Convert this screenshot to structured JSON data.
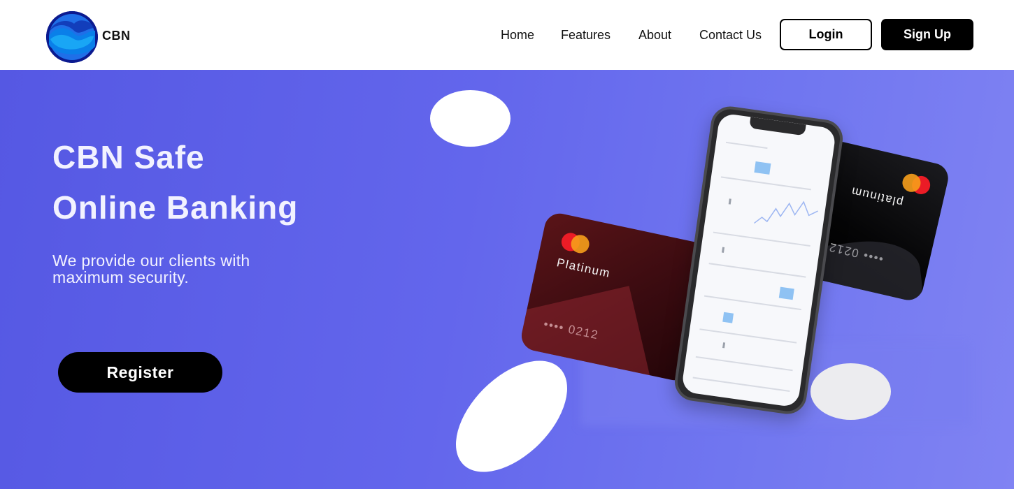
{
  "brand": {
    "name": "CBN"
  },
  "nav": {
    "items": [
      "Home",
      "Features",
      "About",
      "Contact Us"
    ],
    "login_label": "Login",
    "signup_label": "Sign Up"
  },
  "hero": {
    "title_line1": "CBN Safe",
    "title_line2": "Online Banking",
    "subtitle": "We provide our clients with maximum security.",
    "register_label": "Register"
  },
  "cards": {
    "red": {
      "tier": "Platinum",
      "number": "•••• 0212"
    },
    "black": {
      "tier": "platinum",
      "number": "•••• 0212"
    }
  },
  "colors": {
    "hero_gradient_start": "#5558e3",
    "hero_gradient_end": "#8083f3",
    "button_dark": "#000000",
    "text_light": "#f2f2ff"
  }
}
